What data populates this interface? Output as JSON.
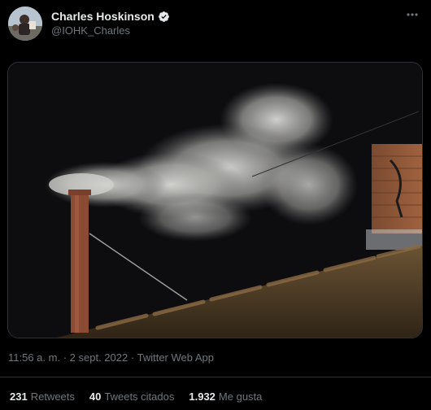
{
  "author": {
    "name": "Charles Hoskinson",
    "handle": "@IOHK_Charles",
    "verified_icon": "verified-badge-icon",
    "avatar_icon": "profile-photo"
  },
  "menu_icon": "more-horizontal-icon",
  "tweet": {
    "time": "11:56 a. m.",
    "separator": "·",
    "date": "2 sept. 2022",
    "source": "Twitter Web App"
  },
  "stats": {
    "retweets": {
      "count": "231",
      "label": "Retweets"
    },
    "quotes": {
      "count": "40",
      "label": "Tweets citados"
    },
    "likes": {
      "count": "1.932",
      "label": "Me gusta"
    }
  },
  "colors": {
    "background": "#000000",
    "text": "#e7e9ea",
    "secondary": "#71767b",
    "border": "#2f3336"
  }
}
